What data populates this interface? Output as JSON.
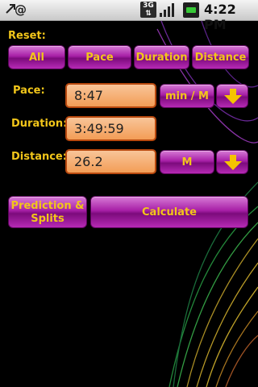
{
  "status_bar": {
    "time": "4:22 PM",
    "network": "3G"
  },
  "reset": {
    "label": "Reset:",
    "buttons": [
      "All",
      "Pace",
      "Duration",
      "Distance"
    ]
  },
  "pace": {
    "label": "Pace:",
    "value": "8:47",
    "unit": "min / M"
  },
  "duration": {
    "label": "Duration:",
    "value": "3:49:59"
  },
  "distance": {
    "label": "Distance:",
    "value": "26.2",
    "unit": "M"
  },
  "actions": {
    "prediction_label": "Prediction & Splits",
    "calculate_label": "Calculate"
  },
  "colors": {
    "accent_text": "#f2c61a",
    "button_purple": "#a71fa6",
    "input_orange": "#f39d56",
    "arrow_yellow": "#f5c400"
  },
  "icons": [
    "usb-icon",
    "gmail-icon",
    "signal-icon",
    "battery-icon",
    "dropdown-arrow-icon"
  ]
}
